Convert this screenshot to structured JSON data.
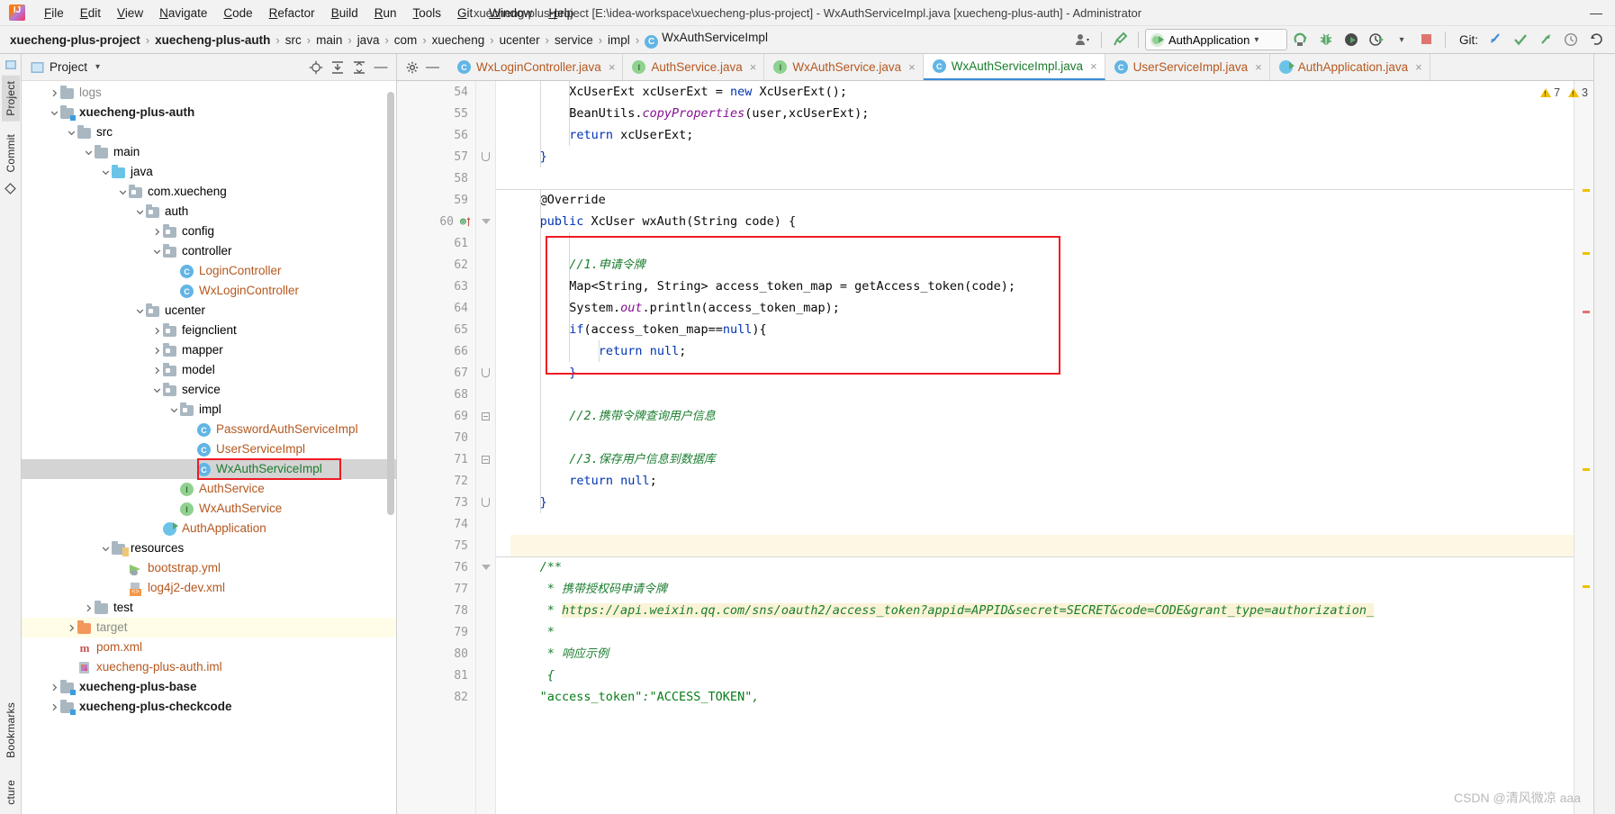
{
  "titlebar": {
    "logo_icon": "intellij-idea-logo",
    "window_title": "xuecheng-plus-project [E:\\idea-workspace\\xuecheng-plus-project] - WxAuthServiceImpl.java [xuecheng-plus-auth] - Administrator",
    "minimize_label": "—",
    "menus": [
      {
        "label": "File",
        "mnemonic": "F"
      },
      {
        "label": "Edit",
        "mnemonic": "E"
      },
      {
        "label": "View",
        "mnemonic": "V"
      },
      {
        "label": "Navigate",
        "mnemonic": "N"
      },
      {
        "label": "Code",
        "mnemonic": "C"
      },
      {
        "label": "Refactor",
        "mnemonic": "R"
      },
      {
        "label": "Build",
        "mnemonic": "B"
      },
      {
        "label": "Run",
        "mnemonic": "R"
      },
      {
        "label": "Tools",
        "mnemonic": "T"
      },
      {
        "label": "Git",
        "mnemonic": "G"
      },
      {
        "label": "Window",
        "mnemonic": "W"
      },
      {
        "label": "Help",
        "mnemonic": "H"
      }
    ]
  },
  "navbar": {
    "breadcrumbs": [
      {
        "label": "xuecheng-plus-project",
        "bold": true,
        "icon": null
      },
      {
        "label": "xuecheng-plus-auth",
        "bold": true,
        "icon": null
      },
      {
        "label": "src",
        "bold": false,
        "icon": null
      },
      {
        "label": "main",
        "bold": false,
        "icon": null
      },
      {
        "label": "java",
        "bold": false,
        "icon": null
      },
      {
        "label": "com",
        "bold": false,
        "icon": null
      },
      {
        "label": "xuecheng",
        "bold": false,
        "icon": null
      },
      {
        "label": "ucenter",
        "bold": false,
        "icon": null
      },
      {
        "label": "service",
        "bold": false,
        "icon": null
      },
      {
        "label": "impl",
        "bold": false,
        "icon": null
      },
      {
        "label": "WxAuthServiceImpl",
        "bold": false,
        "icon": "class-icon"
      }
    ],
    "separator": "›",
    "run_config": {
      "name": "AuthApplication",
      "icon": "spring-boot-icon",
      "dropdown": "▾"
    },
    "buttons": [
      {
        "name": "user-avatar-dropdown",
        "icon": "user-icon"
      },
      {
        "name": "build-hammer",
        "icon": "hammer-icon"
      },
      {
        "name": "rerun",
        "icon": "rerun-icon"
      },
      {
        "name": "debug",
        "icon": "bug-icon"
      },
      {
        "name": "run-with-coverage",
        "icon": "coverage-icon"
      },
      {
        "name": "profiler",
        "icon": "profiler-icon"
      },
      {
        "name": "stop",
        "icon": "stop-icon"
      }
    ],
    "git": {
      "label": "Git:",
      "actions": [
        "update-project",
        "commit",
        "push",
        "history",
        "rollback"
      ]
    }
  },
  "left_strip": {
    "tabs": [
      {
        "label": "Project",
        "active": true
      },
      {
        "label": "Commit",
        "active": false
      }
    ],
    "bottom_tabs": [
      {
        "label": "Bookmarks",
        "active": false
      },
      {
        "label": "cture",
        "active": false
      }
    ]
  },
  "project_panel": {
    "title": "Project",
    "dropdown": "▾",
    "actions": [
      "locate-icon",
      "expand-all-icon",
      "collapse-all-icon",
      "hide-icon"
    ],
    "tree": [
      {
        "depth": 1,
        "label": "logs",
        "arrow": "collapsed",
        "icon": "folder",
        "style": "gray"
      },
      {
        "depth": 1,
        "label": "xuecheng-plus-auth",
        "arrow": "expanded",
        "icon": "folder-module",
        "style": "module"
      },
      {
        "depth": 2,
        "label": "src",
        "arrow": "expanded",
        "icon": "folder",
        "style": "plain"
      },
      {
        "depth": 3,
        "label": "main",
        "arrow": "expanded",
        "icon": "folder",
        "style": "plain"
      },
      {
        "depth": 4,
        "label": "java",
        "arrow": "expanded",
        "icon": "folder-blue",
        "style": "plain"
      },
      {
        "depth": 5,
        "label": "com.xuecheng",
        "arrow": "expanded",
        "icon": "package",
        "style": "plain"
      },
      {
        "depth": 6,
        "label": "auth",
        "arrow": "expanded",
        "icon": "package",
        "style": "plain"
      },
      {
        "depth": 7,
        "label": "config",
        "arrow": "collapsed",
        "icon": "package",
        "style": "plain"
      },
      {
        "depth": 7,
        "label": "controller",
        "arrow": "expanded",
        "icon": "package",
        "style": "plain"
      },
      {
        "depth": 8,
        "label": "LoginController",
        "arrow": "none",
        "icon": "class",
        "style": "class"
      },
      {
        "depth": 8,
        "label": "WxLoginController",
        "arrow": "none",
        "icon": "class",
        "style": "class"
      },
      {
        "depth": 6,
        "label": "ucenter",
        "arrow": "expanded",
        "icon": "package",
        "style": "plain"
      },
      {
        "depth": 7,
        "label": "feignclient",
        "arrow": "collapsed",
        "icon": "package",
        "style": "plain"
      },
      {
        "depth": 7,
        "label": "mapper",
        "arrow": "collapsed",
        "icon": "package",
        "style": "plain"
      },
      {
        "depth": 7,
        "label": "model",
        "arrow": "collapsed",
        "icon": "package",
        "style": "plain"
      },
      {
        "depth": 7,
        "label": "service",
        "arrow": "expanded",
        "icon": "package",
        "style": "plain"
      },
      {
        "depth": 8,
        "label": "impl",
        "arrow": "expanded",
        "icon": "package",
        "style": "plain"
      },
      {
        "depth": 9,
        "label": "PasswordAuthServiceImpl",
        "arrow": "none",
        "icon": "class",
        "style": "class"
      },
      {
        "depth": 9,
        "label": "UserServiceImpl",
        "arrow": "none",
        "icon": "class",
        "style": "class"
      },
      {
        "depth": 9,
        "label": "WxAuthServiceImpl",
        "arrow": "none",
        "icon": "class",
        "style": "green",
        "selected": true,
        "highlighted": true
      },
      {
        "depth": 8,
        "label": "AuthService",
        "arrow": "none",
        "icon": "interface",
        "style": "class"
      },
      {
        "depth": 8,
        "label": "WxAuthService",
        "arrow": "none",
        "icon": "interface",
        "style": "class"
      },
      {
        "depth": 7,
        "label": "AuthApplication",
        "arrow": "none",
        "icon": "spring-boot",
        "style": "class"
      },
      {
        "depth": 4,
        "label": "resources",
        "arrow": "expanded",
        "icon": "folder-res",
        "style": "plain"
      },
      {
        "depth": 5,
        "label": "bootstrap.yml",
        "arrow": "none",
        "icon": "yml",
        "style": "class"
      },
      {
        "depth": 5,
        "label": "log4j2-dev.xml",
        "arrow": "none",
        "icon": "xml",
        "style": "class"
      },
      {
        "depth": 3,
        "label": "test",
        "arrow": "collapsed",
        "icon": "folder",
        "style": "plain"
      },
      {
        "depth": 2,
        "label": "target",
        "arrow": "collapsed",
        "icon": "folder-orange",
        "style": "gray",
        "yellowbg": true
      },
      {
        "depth": 2,
        "label": "pom.xml",
        "arrow": "none",
        "icon": "maven",
        "style": "class"
      },
      {
        "depth": 2,
        "label": "xuecheng-plus-auth.iml",
        "arrow": "none",
        "icon": "iml",
        "style": "class"
      },
      {
        "depth": 1,
        "label": "xuecheng-plus-base",
        "arrow": "collapsed",
        "icon": "folder-module",
        "style": "module"
      },
      {
        "depth": 1,
        "label": "xuecheng-plus-checkcode",
        "arrow": "collapsed",
        "icon": "folder-module",
        "style": "module"
      }
    ]
  },
  "editor": {
    "tabs": [
      {
        "label": "WxLoginController.java",
        "icon": "class-icon",
        "active": false,
        "close": "×"
      },
      {
        "label": "AuthService.java",
        "icon": "interface-icon",
        "active": false,
        "close": "×"
      },
      {
        "label": "WxAuthService.java",
        "icon": "interface-icon",
        "active": false,
        "close": "×"
      },
      {
        "label": "WxAuthServiceImpl.java",
        "icon": "class-icon",
        "active": true,
        "close": "×"
      },
      {
        "label": "UserServiceImpl.java",
        "icon": "class-icon",
        "active": false,
        "close": "×"
      },
      {
        "label": "AuthApplication.java",
        "icon": "spring-boot-icon",
        "active": false,
        "close": "×"
      }
    ],
    "tab_actions": [
      "settings-gear-icon",
      "hide-minus-icon"
    ],
    "warnings": [
      {
        "icon": "warning-triangle-icon",
        "count": "7"
      },
      {
        "icon": "warning-triangle-icon",
        "count": "3"
      }
    ],
    "line_numbers": [
      "54",
      "55",
      "56",
      "57",
      "58",
      "59",
      "60",
      "61",
      "62",
      "63",
      "64",
      "65",
      "66",
      "67",
      "68",
      "69",
      "70",
      "71",
      "72",
      "73",
      "74",
      "75",
      "76",
      "77",
      "78",
      "79",
      "80",
      "81",
      "82"
    ],
    "lines": [
      {
        "num": "54",
        "indent": 2,
        "tokens": [
          {
            "t": "plain",
            "v": "XcUserExt xcUserExt = "
          },
          {
            "t": "kw",
            "v": "new"
          },
          {
            "t": "plain",
            "v": " XcUserExt();"
          }
        ]
      },
      {
        "num": "55",
        "indent": 2,
        "tokens": [
          {
            "t": "plain",
            "v": "BeanUtils."
          },
          {
            "t": "fld",
            "v": "copyProperties"
          },
          {
            "t": "plain",
            "v": "(user,xcUserExt);"
          }
        ]
      },
      {
        "num": "56",
        "indent": 2,
        "tokens": [
          {
            "t": "kw",
            "v": "return"
          },
          {
            "t": "plain",
            "v": " xcUserExt;"
          }
        ]
      },
      {
        "num": "57",
        "indent": 1,
        "tokens": [
          {
            "t": "kw",
            "v": "}"
          }
        ]
      },
      {
        "num": "58",
        "indent": 0,
        "tokens": []
      },
      {
        "num": "59",
        "indent": 1,
        "tokens": [
          {
            "t": "ann",
            "v": "@Override"
          }
        ]
      },
      {
        "num": "60",
        "indent": 1,
        "tokens": [
          {
            "t": "kw",
            "v": "public"
          },
          {
            "t": "plain",
            "v": " XcUser "
          },
          {
            "t": "mth",
            "v": "wxAuth"
          },
          {
            "t": "plain",
            "v": "(String code) {"
          }
        ]
      },
      {
        "num": "61",
        "indent": 0,
        "tokens": []
      },
      {
        "num": "62",
        "indent": 2,
        "tokens": [
          {
            "t": "cmt",
            "v": "//1."
          },
          {
            "t": "cmt-cn",
            "v": "申请令牌"
          }
        ]
      },
      {
        "num": "63",
        "indent": 2,
        "tokens": [
          {
            "t": "plain",
            "v": "Map<String, String> access_token_map = getAccess_token(code);"
          }
        ]
      },
      {
        "num": "64",
        "indent": 2,
        "tokens": [
          {
            "t": "plain",
            "v": "System."
          },
          {
            "t": "fld",
            "v": "out"
          },
          {
            "t": "plain",
            "v": ".println(access_token_map);"
          }
        ]
      },
      {
        "num": "65",
        "indent": 2,
        "tokens": [
          {
            "t": "kw",
            "v": "if"
          },
          {
            "t": "plain",
            "v": "(access_token_map=="
          },
          {
            "t": "kw",
            "v": "null"
          },
          {
            "t": "plain",
            "v": "){"
          }
        ]
      },
      {
        "num": "66",
        "indent": 3,
        "tokens": [
          {
            "t": "kw",
            "v": "return"
          },
          {
            "t": "plain",
            "v": " "
          },
          {
            "t": "kw",
            "v": "null"
          },
          {
            "t": "plain",
            "v": ";"
          }
        ]
      },
      {
        "num": "67",
        "indent": 2,
        "tokens": [
          {
            "t": "kw",
            "v": "}"
          }
        ]
      },
      {
        "num": "68",
        "indent": 0,
        "tokens": []
      },
      {
        "num": "69",
        "indent": 2,
        "tokens": [
          {
            "t": "cmt",
            "v": "//2."
          },
          {
            "t": "cmt-cn",
            "v": "携带令牌查询用户信息"
          }
        ]
      },
      {
        "num": "70",
        "indent": 0,
        "tokens": []
      },
      {
        "num": "71",
        "indent": 2,
        "tokens": [
          {
            "t": "cmt",
            "v": "//3."
          },
          {
            "t": "cmt-cn",
            "v": "保存用户信息到数据库"
          }
        ]
      },
      {
        "num": "72",
        "indent": 2,
        "tokens": [
          {
            "t": "kw",
            "v": "return"
          },
          {
            "t": "plain",
            "v": " "
          },
          {
            "t": "kw",
            "v": "null"
          },
          {
            "t": "plain",
            "v": ";"
          }
        ]
      },
      {
        "num": "73",
        "indent": 1,
        "tokens": [
          {
            "t": "kw",
            "v": "}"
          }
        ]
      },
      {
        "num": "74",
        "indent": 0,
        "tokens": []
      },
      {
        "num": "75",
        "indent": 0,
        "tokens": [],
        "highlight": true
      },
      {
        "num": "76",
        "indent": 1,
        "tokens": [
          {
            "t": "cmt",
            "v": "/**"
          }
        ]
      },
      {
        "num": "77",
        "indent": 1,
        "tokens": [
          {
            "t": "cmt",
            "v": " * "
          },
          {
            "t": "cmt-cn",
            "v": "携带授权码申请令牌"
          }
        ]
      },
      {
        "num": "78",
        "indent": 1,
        "tokens": [
          {
            "t": "cmt",
            "v": " * "
          },
          {
            "t": "link",
            "v": "https://api.weixin.qq.com/sns/oauth2/access_token?appid=APPID&secret=SECRET&code=CODE&grant_type=authorization_"
          }
        ]
      },
      {
        "num": "79",
        "indent": 1,
        "tokens": [
          {
            "t": "cmt",
            "v": " *"
          }
        ]
      },
      {
        "num": "80",
        "indent": 1,
        "tokens": [
          {
            "t": "cmt",
            "v": " * "
          },
          {
            "t": "cmt-cn",
            "v": "响应示例"
          }
        ]
      },
      {
        "num": "81",
        "indent": 1,
        "tokens": [
          {
            "t": "cmt",
            "v": " {"
          }
        ]
      },
      {
        "num": "82",
        "indent": 1,
        "tokens": [
          {
            "t": "str",
            "v": "\"access_token\""
          },
          {
            "t": "cmt",
            "v": ":"
          },
          {
            "t": "str",
            "v": "\"ACCESS_TOKEN\""
          },
          {
            "t": "cmt",
            "v": ","
          }
        ]
      }
    ],
    "gutter_marks": [
      {
        "line": "60",
        "icon": "override-method-icon"
      }
    ]
  },
  "watermark": "CSDN @清风微凉 aaa",
  "colors": {
    "accent_blue": "#3c8cd6",
    "annotation_red": "#ee1b24",
    "class_name": "#b5581f",
    "green_text": "#1a7d2e",
    "keyword_blue": "#0033b3",
    "comment_green": "#1a7d2e",
    "string_green": "#067d17",
    "field_purple": "#871094",
    "selection_gray": "#d4d4d4",
    "highlight_yellow": "#fdf8e4",
    "panel_bg": "#f2f2f2"
  }
}
